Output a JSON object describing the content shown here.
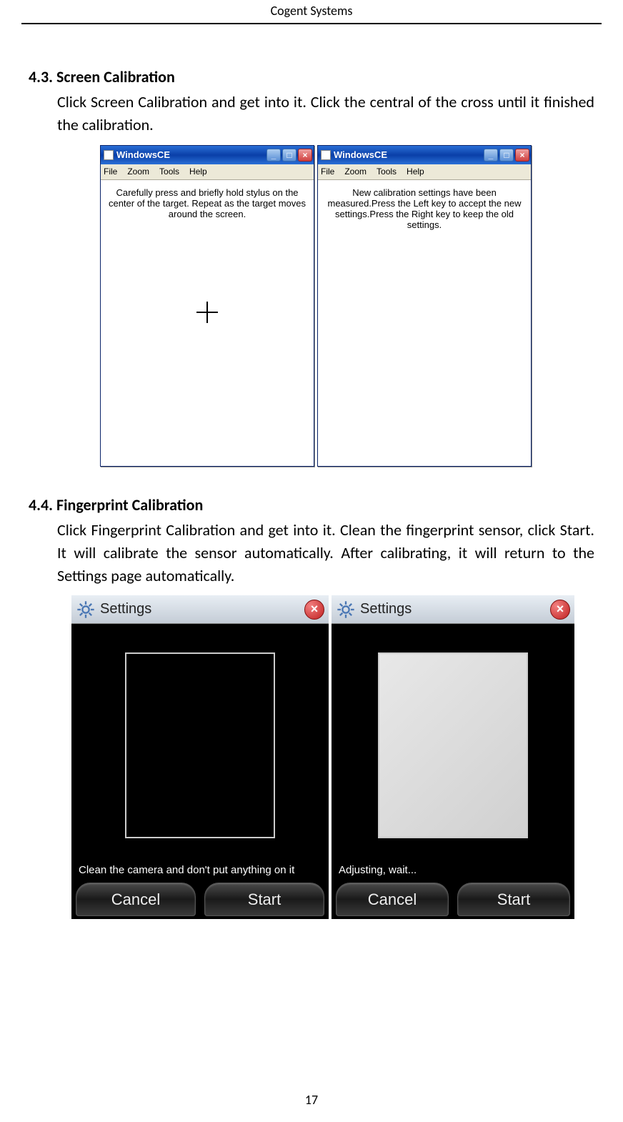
{
  "header": {
    "company": "Cogent Systems"
  },
  "section1": {
    "heading": "4.3. Screen Calibration",
    "body": "Click Screen Calibration and get into it. Click the central of the cross until it finished the calibration."
  },
  "wince": {
    "title": "WindowsCE",
    "menu": {
      "file": "File",
      "zoom": "Zoom",
      "tools": "Tools",
      "help": "Help"
    },
    "left_text": "Carefully press and briefly hold stylus on the center of the target. Repeat as the target moves around the screen.",
    "right_text": "New calibration settings have been measured.Press the Left key to accept the new settings.Press the Right key to keep the old settings."
  },
  "section2": {
    "heading": "4.4. Fingerprint Calibration",
    "body": "Click Fingerprint Calibration and get into it. Clean the fingerprint sensor, click Start. It will calibrate the sensor automatically. After calibrating, it will return to the Settings page automatically."
  },
  "settings": {
    "title": "Settings",
    "msg_left": "Clean the camera and don't put anything on it",
    "msg_right": "Adjusting, wait...",
    "btn_cancel": "Cancel",
    "btn_start": "Start"
  },
  "page_number": "17"
}
